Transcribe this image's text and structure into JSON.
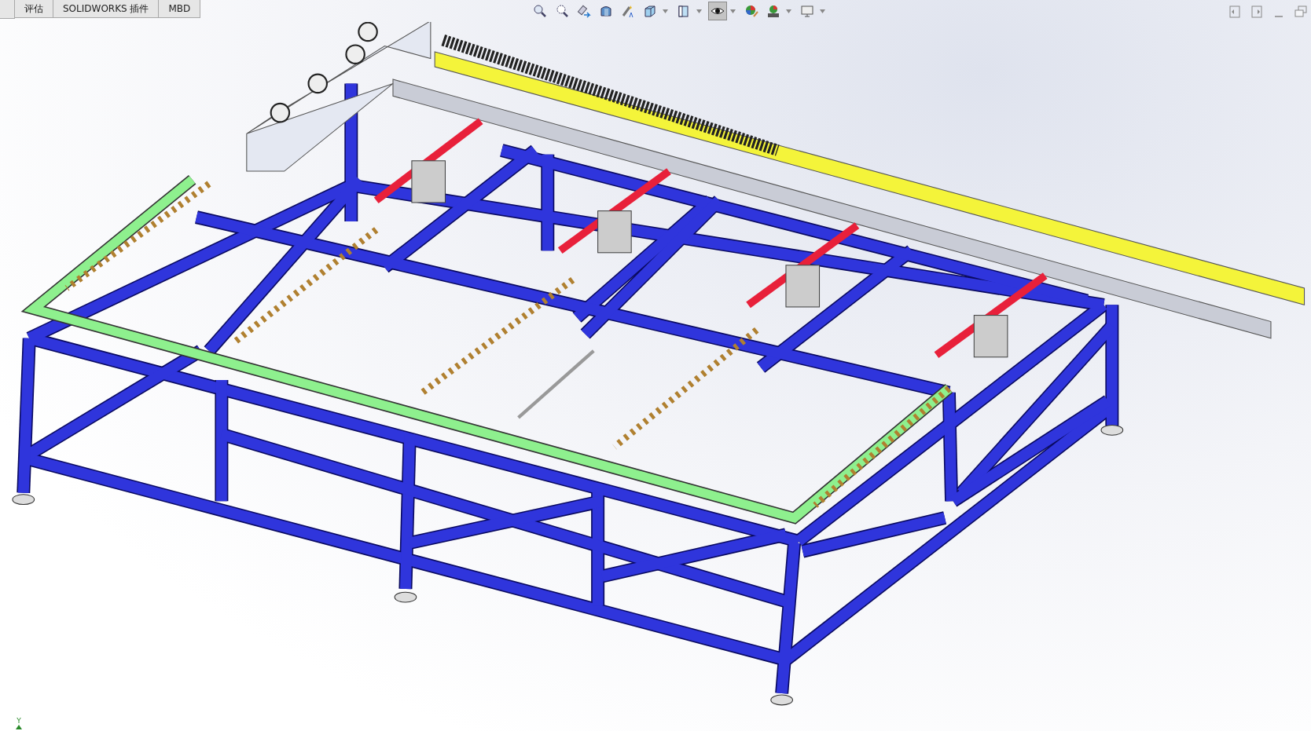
{
  "tabs": [
    {
      "label": "评估",
      "selected": false
    },
    {
      "label": "SOLIDWORKS 插件",
      "selected": false
    },
    {
      "label": "MBD",
      "selected": false
    }
  ],
  "hide_show_button": {
    "pressed": true
  },
  "triad": {
    "axis_label": "Y"
  }
}
